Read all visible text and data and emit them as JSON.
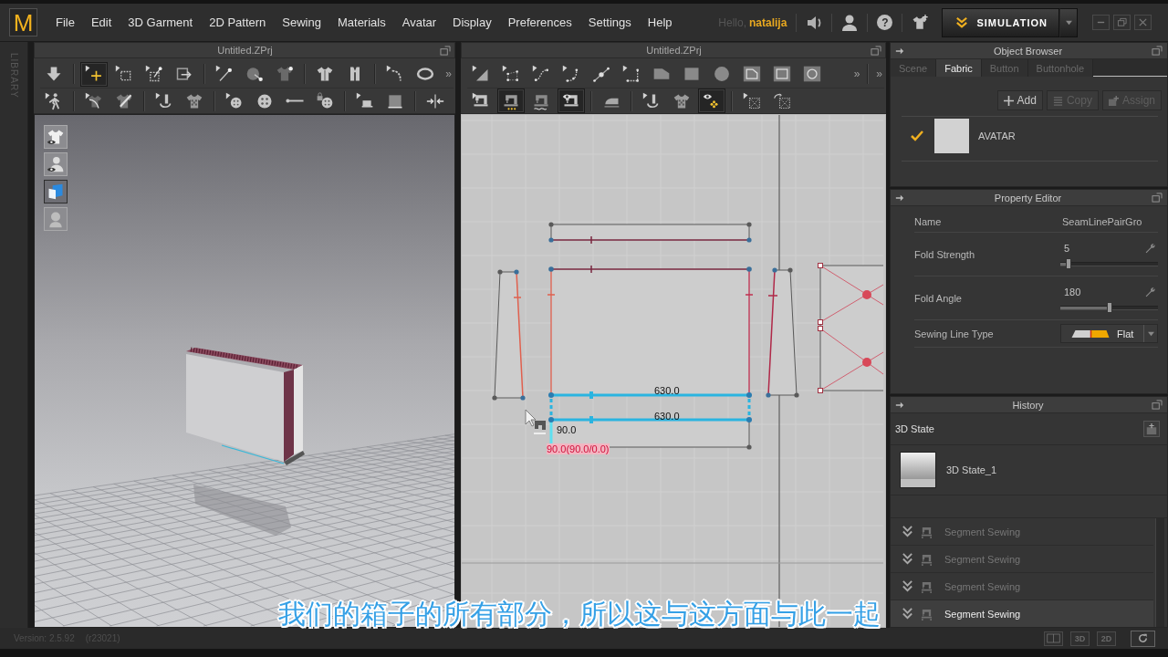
{
  "app": {
    "logo": "M",
    "menu": [
      "File",
      "Edit",
      "3D Garment",
      "2D Pattern",
      "Sewing",
      "Materials",
      "Avatar",
      "Display",
      "Preferences",
      "Settings",
      "Help"
    ],
    "greeting": "Hello,",
    "user": "natalija",
    "help": "?",
    "mode": "SIMULATION"
  },
  "library_tab": "LIBRARY",
  "window_3d": {
    "title": "Untitled.ZPrj",
    "toolbar_rows": [
      [
        {
          "selected": false
        },
        {
          "selected": true
        },
        {
          "selected": false
        },
        {
          "selected": false
        },
        {
          "selected": false
        },
        {
          "selected": false
        },
        {
          "selected": false
        },
        {
          "selected": false
        },
        {
          "selected": false
        },
        {
          "selected": false
        },
        {
          "selected": false
        },
        {
          "selected": false
        }
      ],
      [
        {
          "selected": false
        },
        {
          "selected": false
        },
        {
          "selected": false
        },
        {
          "selected": false
        },
        {
          "selected": false
        },
        {
          "selected": false
        },
        {
          "selected": false
        },
        {
          "selected": false
        },
        {
          "selected": false
        },
        {
          "selected": false
        },
        {
          "selected": false
        },
        {
          "selected": false
        }
      ]
    ],
    "overflow": [
      "»"
    ],
    "view_toggles": [
      {
        "selected": false
      },
      {
        "selected": false
      },
      {
        "selected": true
      },
      {
        "selected": false
      }
    ]
  },
  "window_2d": {
    "title": "Untitled.ZPrj",
    "toolbar_rows": [
      [
        {
          "selected": false
        },
        {
          "selected": false
        },
        {
          "selected": false
        },
        {
          "selected": false
        },
        {
          "selected": false
        },
        {
          "selected": false
        },
        {
          "selected": false
        },
        {
          "selected": false
        },
        {
          "selected": false
        },
        {
          "selected": false
        },
        {
          "selected": false
        },
        {
          "selected": false
        }
      ],
      [
        {
          "selected": false
        },
        {
          "selected": true
        },
        {
          "selected": false
        },
        {
          "selected": true
        },
        {
          "selected": false
        },
        {
          "selected": false
        },
        {
          "selected": false
        },
        {
          "selected": true
        },
        {
          "selected": false
        },
        {
          "selected": false
        }
      ]
    ],
    "overflow": [
      "»",
      "»"
    ],
    "pattern_labels": [
      {
        "text": "630.0",
        "kind": "length"
      },
      {
        "text": "630.0",
        "kind": "length"
      },
      {
        "text": "90.0",
        "kind": "length"
      },
      {
        "text": "90.0(90.0/0.0)",
        "kind": "angle"
      }
    ]
  },
  "object_browser": {
    "title": "Object Browser",
    "tabs": [
      {
        "label": "Scene",
        "selected": false
      },
      {
        "label": "Fabric",
        "selected": true
      },
      {
        "label": "Button",
        "selected": false
      },
      {
        "label": "Buttonhole",
        "selected": false
      }
    ],
    "actions": [
      {
        "label": "Add",
        "disabled": false
      },
      {
        "label": "Copy",
        "disabled": true
      },
      {
        "label": "Assign",
        "disabled": true
      }
    ],
    "fabrics": [
      {
        "name": "AVATAR",
        "checked": true
      }
    ]
  },
  "property_editor": {
    "title": "Property Editor",
    "rows": [
      {
        "kind": "text",
        "label": "Name",
        "value": "SeamLinePairGro"
      },
      {
        "kind": "slider",
        "label": "Fold Strength",
        "value": "5",
        "level": 0.08
      },
      {
        "kind": "slider",
        "label": "Fold Angle",
        "value": "180",
        "level": 0.5
      },
      {
        "kind": "select",
        "label": "Sewing Line Type",
        "value": "Flat"
      }
    ]
  },
  "history": {
    "title": "History",
    "section": "3D State",
    "states": [
      {
        "name": "3D State_1"
      }
    ],
    "steps": [
      {
        "label": "Segment Sewing",
        "selected": false
      },
      {
        "label": "Segment Sewing",
        "selected": false
      },
      {
        "label": "Segment Sewing",
        "selected": false
      },
      {
        "label": "Segment Sewing",
        "selected": true
      }
    ]
  },
  "status_bar": {
    "version": "Version: 2.5.92",
    "build": "(r23021)",
    "view_buttons": [
      "3D",
      "2D"
    ]
  },
  "subtitle": "我们的箱子的所有部分，所以这与这方面与此一起"
}
